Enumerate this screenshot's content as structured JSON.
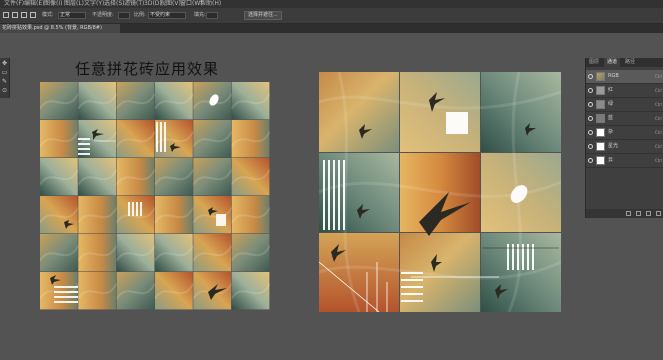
{
  "menubar": {
    "items": [
      "文件(F)",
      "编辑(E)",
      "图像(I)",
      "图层(L)",
      "文字(Y)",
      "选择(S)",
      "滤镜(T)",
      "3D(D)",
      "视图(V)",
      "窗口(W)",
      "帮助(H)"
    ]
  },
  "options": {
    "mode_label": "模式:",
    "mode_value": "正常",
    "opacity_label": "不透明度:",
    "fill_label": "填充:",
    "ratio_label": "比例:",
    "ratio_value": "不受约束",
    "action_button": "选择并遮住..."
  },
  "tab": {
    "doc_name": "花砖拼贴效果.psd @ 8.5% (背景, RGB/8#)"
  },
  "document": {
    "title": "任意拼花砖应用效果"
  },
  "layers_panel": {
    "tabs": [
      "图层",
      "通道",
      "路径"
    ],
    "active_tab": 1,
    "layers": [
      {
        "name": "RGB"
      },
      {
        "name": "红"
      },
      {
        "name": "绿"
      },
      {
        "name": "蓝"
      },
      {
        "name": "杂"
      },
      {
        "name": "星光"
      },
      {
        "name": "云"
      }
    ]
  },
  "colors": {
    "app_bg": "#535353",
    "panel_bg": "#3f3f3f",
    "menubar_bg": "#323232"
  },
  "icons": {
    "toolbar": [
      "move-icon",
      "marquee-icon",
      "brush-icon",
      "eyedropper-icon"
    ]
  }
}
